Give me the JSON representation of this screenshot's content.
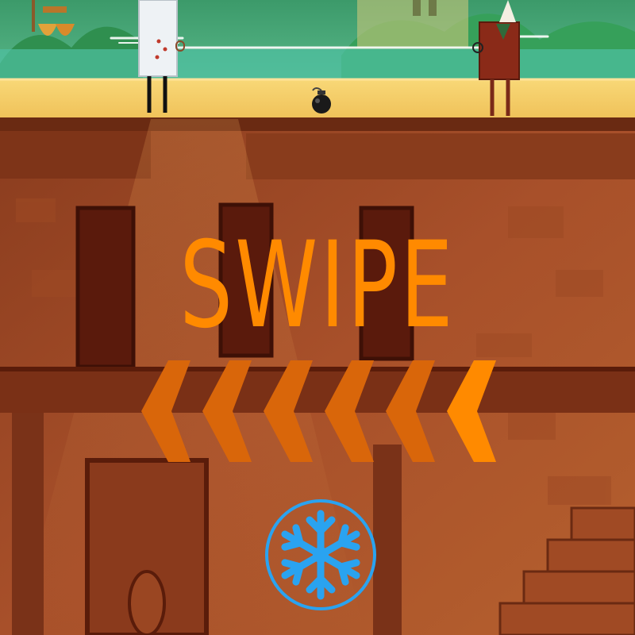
{
  "hud": {
    "instruction": "SWIPE",
    "swipe_direction": "left",
    "chevron_count": 6
  },
  "powerup": {
    "icon": "snowflake-icon",
    "color": "#2aa3f0"
  },
  "colors": {
    "accent": "#ff8a00",
    "chevron_dim": "#d9660a",
    "chevron_bright": "#ff8a00",
    "sky_top": "#2c8a5a",
    "ground": "#f6cf6a"
  },
  "characters": [
    {
      "name": "chef-character"
    },
    {
      "name": "villain-character"
    }
  ],
  "props": [
    {
      "name": "bomb-item"
    }
  ]
}
